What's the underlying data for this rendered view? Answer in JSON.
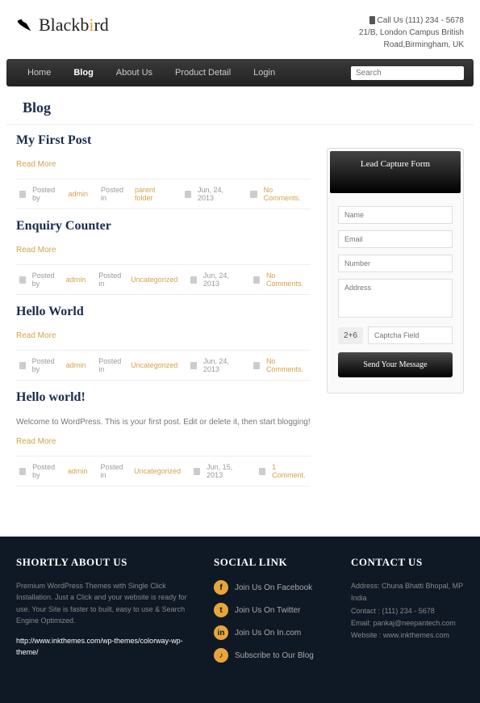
{
  "header": {
    "logo": "Blackbird",
    "phone_label": "Call Us (111) 234 - 5678",
    "address1": "21/B, London Campus British",
    "address2": "Road,Birmingham, UK"
  },
  "nav": {
    "items": [
      "Home",
      "Blog",
      "About Us",
      "Product Detail",
      "Login"
    ],
    "search_placeholder": "Search"
  },
  "page_title": "Blog",
  "posts": [
    {
      "title": "My First Post",
      "excerpt": "",
      "read_more": "Read More",
      "author": "admin",
      "category": "parent folder",
      "date": "Jun, 24, 2013",
      "comments": "No Comments."
    },
    {
      "title": "Enquiry Counter",
      "excerpt": "",
      "read_more": "Read More",
      "author": "admin",
      "category": "Uncategorized",
      "date": "Jun, 24, 2013",
      "comments": "No Comments."
    },
    {
      "title": "Hello World",
      "excerpt": "",
      "read_more": "Read More",
      "author": "admin",
      "category": "Uncategorized",
      "date": "Jun, 24, 2013",
      "comments": "No Comments."
    },
    {
      "title": "Hello world!",
      "excerpt": "Welcome to WordPress. This is your first post. Edit or delete it, then start blogging!",
      "read_more": "Read More",
      "author": "admin",
      "category": "Uncategorized",
      "date": "Jun, 15, 2013",
      "comments": "1 Comment."
    }
  ],
  "meta_labels": {
    "posted_by": "Posted by",
    "posted_in": "Posted in"
  },
  "sidebar": {
    "title": "Lead Capture Form",
    "name_ph": "Name",
    "email_ph": "Email",
    "number_ph": "Number",
    "address_ph": "Address",
    "captcha_q": "2+6",
    "captcha_ph": "Captcha Field",
    "submit": "Send Your Message"
  },
  "footer": {
    "about_title": "SHORTLY ABOUT US",
    "about_text": "Premium WordPress Themes with Single Click Installation. Just a Click and your website is ready for use. Your Site is faster to built, easy to use & Search Engine Optimized.",
    "about_link": "http://www.inkthemes.com/wp-themes/colorway-wp-theme/",
    "social_title": "SOCIAL LINK",
    "social": [
      {
        "icon": "f",
        "label": "Join Us On Facebook"
      },
      {
        "icon": "t",
        "label": "Join Us On Twitter"
      },
      {
        "icon": "in",
        "label": "Join Us On In.com"
      },
      {
        "icon": "♪",
        "label": "Subscribe to Our Blog"
      }
    ],
    "contact_title": "CONTACT US",
    "contact_address": "Address: Chuna Bhatti Bhopal, MP India",
    "contact_phone": "Contact : (111) 234 - 5678",
    "contact_email": "Email: pankaj@neepantech.com",
    "contact_web": "Website : www.inkthemes.com"
  }
}
